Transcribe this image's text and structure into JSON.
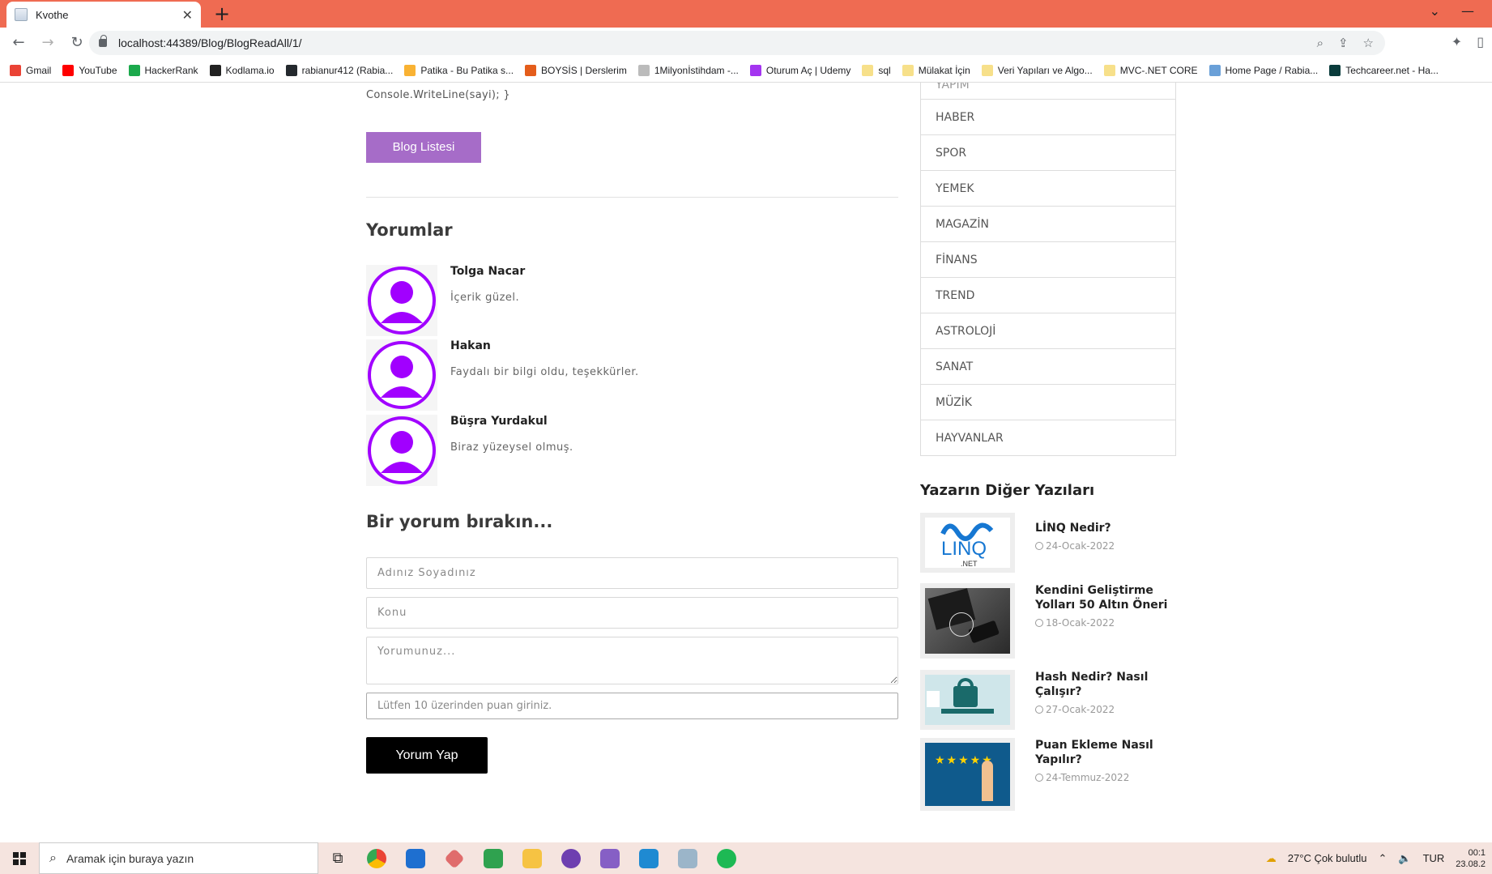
{
  "browser": {
    "tab_title": "Kvothe",
    "url": "localhost:44389/Blog/BlogReadAll/1/",
    "bookmarks": [
      {
        "label": "Gmail",
        "color": "#ea4335"
      },
      {
        "label": "YouTube",
        "color": "#ff0000"
      },
      {
        "label": "HackerRank",
        "color": "#1ba94c"
      },
      {
        "label": "Kodlama.io",
        "color": "#222222"
      },
      {
        "label": "rabianur412 (Rabia...",
        "color": "#24292e"
      },
      {
        "label": "Patika - Bu Patika s...",
        "color": "#f9b233"
      },
      {
        "label": "BOYSİS | Derslerim",
        "color": "#e45d1b"
      },
      {
        "label": "1Milyonİstihdam -...",
        "color": "#bbbbbb"
      },
      {
        "label": "Oturum Aç | Udemy",
        "color": "#a435f0"
      },
      {
        "label": "sql",
        "color": "#f7e08a"
      },
      {
        "label": "Mülakat İçin",
        "color": "#f7e08a"
      },
      {
        "label": "Veri Yapıları ve Algo...",
        "color": "#f7e08a"
      },
      {
        "label": "MVC-.NET CORE",
        "color": "#f7e08a"
      },
      {
        "label": "Home Page / Rabia...",
        "color": "#6aa0d8"
      },
      {
        "label": "Techcareer.net - Ha...",
        "color": "#0a3c3c"
      }
    ]
  },
  "article": {
    "code_tail": "Console.WriteLine(sayi); }",
    "back_button": "Blog Listesi"
  },
  "comments": {
    "heading": "Yorumlar",
    "items": [
      {
        "name": "Tolga Nacar",
        "text": "İçerik güzel."
      },
      {
        "name": "Hakan",
        "text": "Faydalı bir bilgi oldu, teşekkürler."
      },
      {
        "name": "Büşra Yurdakul",
        "text": "Biraz yüzeysel olmuş."
      }
    ]
  },
  "comment_form": {
    "heading": "Bir yorum bırakın...",
    "name_placeholder": "Adınız Soyadınız",
    "subject_placeholder": "Konu",
    "message_placeholder": "Yorumunuz...",
    "rating_placeholder": "Lütfen 10 üzerinden puan giriniz.",
    "submit_label": "Yorum Yap"
  },
  "sidebar": {
    "categories_partial": "YAPIM",
    "categories": [
      "HABER",
      "SPOR",
      "YEMEK",
      "MAGAZİN",
      "FİNANS",
      "TREND",
      "ASTROLOJİ",
      "SANAT",
      "MÜZİK",
      "HAYVANLAR"
    ],
    "other_posts_heading": "Yazarın Diğer Yazıları",
    "other_posts": [
      {
        "title": "LİNQ Nedir?",
        "date": "24-Ocak-2022"
      },
      {
        "title": "Kendini Geliştirme Yolları 50 Altın Öneri",
        "date": "18-Ocak-2022"
      },
      {
        "title": "Hash Nedir? Nasıl Çalışır?",
        "date": "27-Ocak-2022"
      },
      {
        "title": "Puan Ekleme Nasıl Yapılır?",
        "date": "24-Temmuz-2022"
      }
    ],
    "thumb_linq_text": "LINQ",
    "thumb_linq_sub": ".NET"
  },
  "taskbar": {
    "search_placeholder": "Aramak için buraya yazın",
    "weather": "27°C  Çok bulutlu",
    "language": "TUR",
    "time": "00:1",
    "date": "23.08.2"
  },
  "colors": {
    "tab_strip": "#ef6b52",
    "accent_purple": "#a66cc8",
    "avatar_purple": "#a100ff",
    "submit_black": "#000000"
  }
}
